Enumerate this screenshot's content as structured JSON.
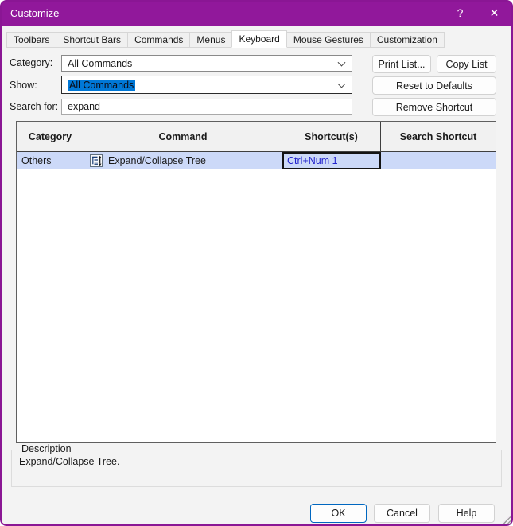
{
  "window": {
    "title": "Customize",
    "help_glyph": "?",
    "close_glyph": "✕"
  },
  "tabs": [
    {
      "label": "Toolbars",
      "active": false
    },
    {
      "label": "Shortcut Bars",
      "active": false
    },
    {
      "label": "Commands",
      "active": false
    },
    {
      "label": "Menus",
      "active": false
    },
    {
      "label": "Keyboard",
      "active": true
    },
    {
      "label": "Mouse Gestures",
      "active": false
    },
    {
      "label": "Customization",
      "active": false
    }
  ],
  "form": {
    "category_label": "Category:",
    "category_value": "All Commands",
    "show_label": "Show:",
    "show_value": "All Commands",
    "search_label": "Search for:",
    "search_value": "expand",
    "print_list_button": "Print List...",
    "copy_list_button": "Copy List",
    "reset_button": "Reset to Defaults",
    "remove_button": "Remove Shortcut"
  },
  "table": {
    "headers": [
      "Category",
      "Command",
      "Shortcut(s)",
      "Search Shortcut"
    ],
    "rows": [
      {
        "category": "Others",
        "command": "Expand/Collapse Tree",
        "shortcut": "Ctrl+Num 1",
        "search_shortcut": "",
        "icon": "expand-collapse-tree-icon",
        "selected": true
      }
    ]
  },
  "description": {
    "legend": "Description",
    "text": "Expand/Collapse Tree."
  },
  "footer": {
    "ok_button": "OK",
    "cancel_button": "Cancel",
    "help_button": "Help"
  },
  "colors": {
    "titlebar": "#91189b",
    "dialog_border": "#8a1694",
    "selected_row": "#ccd9f8",
    "shortcut_text": "#2222cc",
    "text_selection_bg": "#0078d7",
    "accent_button_border": "#0067c0"
  }
}
